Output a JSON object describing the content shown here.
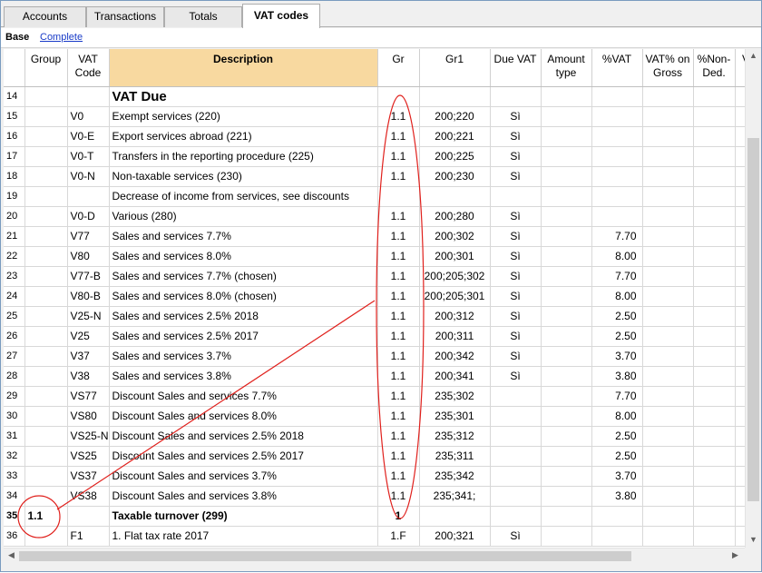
{
  "tabs": [
    "Accounts",
    "Transactions",
    "Totals",
    "VAT codes"
  ],
  "views": {
    "active": "Base",
    "other": "Complete"
  },
  "columns": {
    "group": "Group",
    "vatcode": "VAT\nCode",
    "description": "Description",
    "gr": "Gr",
    "gr1": "Gr1",
    "duevat": "Due VAT",
    "amounttype": "Amount\ntype",
    "pvat": "%VAT",
    "vatgross": "VAT% on\nGross",
    "nonded": "%Non-\nDed.",
    "extra": "V"
  },
  "rows": [
    {
      "n": "14",
      "group": "",
      "code": "",
      "desc": "VAT Due",
      "gr": "",
      "gr1": "",
      "due": "",
      "pct": ""
    },
    {
      "n": "15",
      "group": "",
      "code": "V0",
      "desc": "Exempt services (220)",
      "gr": "1.1",
      "gr1": "200;220",
      "due": "Sì",
      "pct": ""
    },
    {
      "n": "16",
      "group": "",
      "code": "V0-E",
      "desc": "Export services abroad (221)",
      "gr": "1.1",
      "gr1": "200;221",
      "due": "Sì",
      "pct": ""
    },
    {
      "n": "17",
      "group": "",
      "code": "V0-T",
      "desc": "Transfers in the reporting procedure (225)",
      "gr": "1.1",
      "gr1": "200;225",
      "due": "Sì",
      "pct": ""
    },
    {
      "n": "18",
      "group": "",
      "code": "V0-N",
      "desc": "Non-taxable services (230)",
      "gr": "1.1",
      "gr1": "200;230",
      "due": "Sì",
      "pct": ""
    },
    {
      "n": "19",
      "group": "",
      "code": "",
      "desc": "Decrease of income from services, see discounts",
      "gr": "",
      "gr1": "",
      "due": "",
      "pct": ""
    },
    {
      "n": "20",
      "group": "",
      "code": "V0-D",
      "desc": "Various (280)",
      "gr": "1.1",
      "gr1": "200;280",
      "due": "Sì",
      "pct": ""
    },
    {
      "n": "21",
      "group": "",
      "code": "V77",
      "desc": "Sales and services 7.7%",
      "gr": "1.1",
      "gr1": "200;302",
      "due": "Sì",
      "pct": "7.70"
    },
    {
      "n": "22",
      "group": "",
      "code": "V80",
      "desc": "Sales and services 8.0%",
      "gr": "1.1",
      "gr1": "200;301",
      "due": "Sì",
      "pct": "8.00"
    },
    {
      "n": "23",
      "group": "",
      "code": "V77-B",
      "desc": "Sales and services 7.7% (chosen)",
      "gr": "1.1",
      "gr1": "200;205;302",
      "due": "Sì",
      "pct": "7.70"
    },
    {
      "n": "24",
      "group": "",
      "code": "V80-B",
      "desc": "Sales and services 8.0% (chosen)",
      "gr": "1.1",
      "gr1": "200;205;301",
      "due": "Sì",
      "pct": "8.00"
    },
    {
      "n": "25",
      "group": "",
      "code": "V25-N",
      "desc": "Sales and services 2.5% 2018",
      "gr": "1.1",
      "gr1": "200;312",
      "due": "Sì",
      "pct": "2.50"
    },
    {
      "n": "26",
      "group": "",
      "code": "V25",
      "desc": "Sales and services 2.5% 2017",
      "gr": "1.1",
      "gr1": "200;311",
      "due": "Sì",
      "pct": "2.50"
    },
    {
      "n": "27",
      "group": "",
      "code": "V37",
      "desc": "Sales and services 3.7%",
      "gr": "1.1",
      "gr1": "200;342",
      "due": "Sì",
      "pct": "3.70"
    },
    {
      "n": "28",
      "group": "",
      "code": "V38",
      "desc": "Sales and services 3.8%",
      "gr": "1.1",
      "gr1": "200;341",
      "due": "Sì",
      "pct": "3.80"
    },
    {
      "n": "29",
      "group": "",
      "code": "VS77",
      "desc": "Discount Sales and services 7.7%",
      "gr": "1.1",
      "gr1": "235;302",
      "due": "",
      "pct": "7.70"
    },
    {
      "n": "30",
      "group": "",
      "code": "VS80",
      "desc": "Discount Sales and services 8.0%",
      "gr": "1.1",
      "gr1": "235;301",
      "due": "",
      "pct": "8.00"
    },
    {
      "n": "31",
      "group": "",
      "code": "VS25-N",
      "desc": "Discount Sales and services 2.5% 2018",
      "gr": "1.1",
      "gr1": "235;312",
      "due": "",
      "pct": "2.50"
    },
    {
      "n": "32",
      "group": "",
      "code": "VS25",
      "desc": "Discount Sales and services 2.5% 2017",
      "gr": "1.1",
      "gr1": "235;311",
      "due": "",
      "pct": "2.50"
    },
    {
      "n": "33",
      "group": "",
      "code": "VS37",
      "desc": "Discount Sales and services 3.7%",
      "gr": "1.1",
      "gr1": "235;342",
      "due": "",
      "pct": "3.70"
    },
    {
      "n": "34",
      "group": "",
      "code": "VS38",
      "desc": "Discount Sales and services 3.8%",
      "gr": "1.1",
      "gr1": "235;341;",
      "due": "",
      "pct": "3.80"
    },
    {
      "n": "35",
      "group": "1.1",
      "code": "",
      "desc": "Taxable turnover (299)",
      "gr": "1",
      "gr1": "",
      "due": "",
      "pct": ""
    },
    {
      "n": "36",
      "group": "",
      "code": "F1",
      "desc": "1. Flat tax rate 2017",
      "gr": "1.F",
      "gr1": "200;321",
      "due": "Sì",
      "pct": ""
    }
  ],
  "annotation_color": "#e0201c"
}
